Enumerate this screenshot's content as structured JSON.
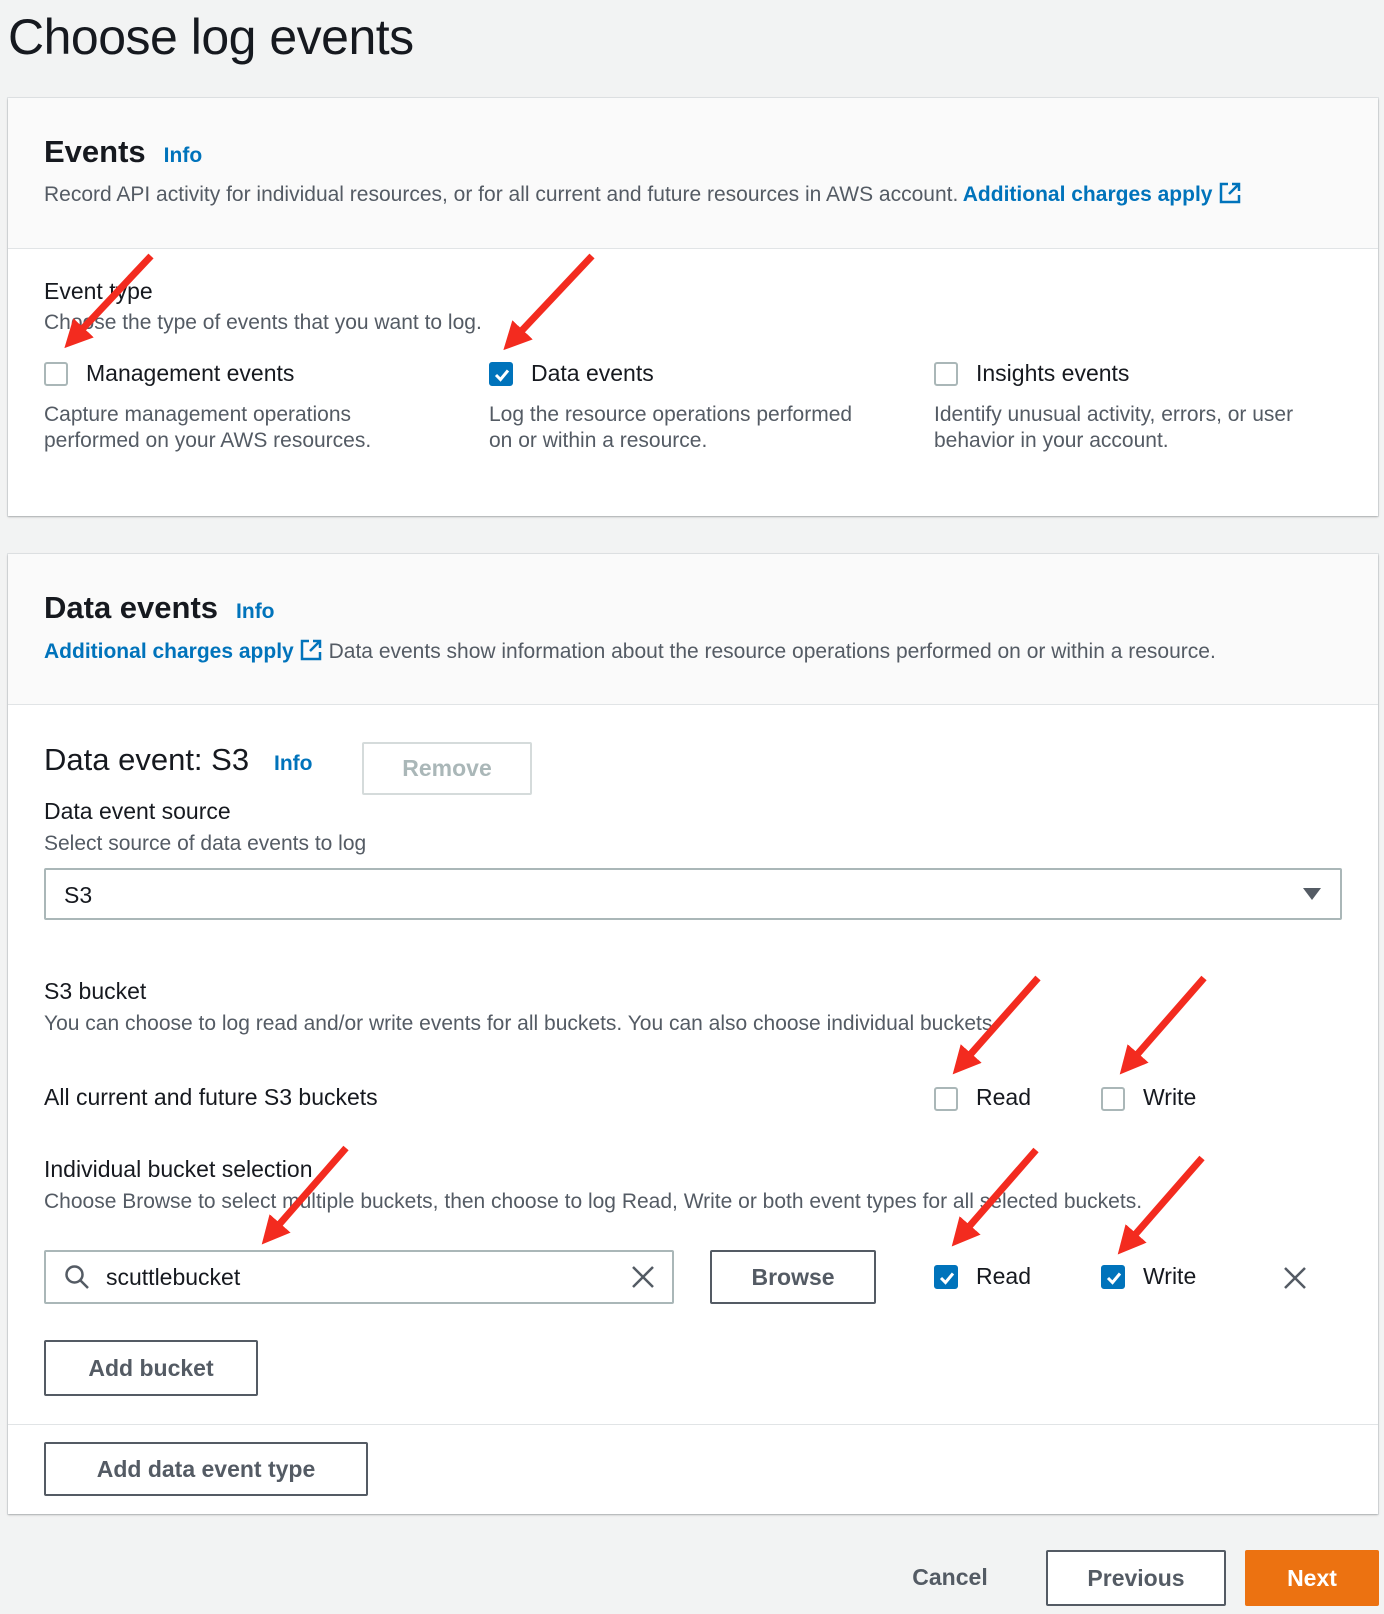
{
  "page": {
    "title": "Choose log events"
  },
  "events_panel": {
    "title": "Events",
    "info": "Info",
    "description": "Record API activity for individual resources, or for all current and future resources in AWS account.",
    "charges_link": "Additional charges apply",
    "event_type_label": "Event type",
    "event_type_desc": "Choose the type of events that you want to log.",
    "options": [
      {
        "label": "Management events",
        "desc1": "Capture management operations",
        "desc2": "performed on your AWS resources.",
        "checked": false
      },
      {
        "label": "Data events",
        "desc1": "Log the resource operations performed",
        "desc2": "on or within a resource.",
        "checked": true
      },
      {
        "label": "Insights events",
        "desc1": "Identify unusual activity, errors, or user",
        "desc2": "behavior in your account.",
        "checked": false
      }
    ]
  },
  "data_panel": {
    "title": "Data events",
    "info": "Info",
    "charges_link": "Additional charges apply",
    "description": "Data events show information about the resource operations performed on or within a resource.",
    "s3_title": "Data event: S3",
    "s3_info": "Info",
    "remove_label": "Remove",
    "source_label": "Data event source",
    "source_desc": "Select source of data events to log",
    "source_value": "S3",
    "bucket_label": "S3 bucket",
    "bucket_desc": "You can choose to log read and/or write events for all buckets. You can also choose individual buckets.",
    "all_buckets_label": "All current and future S3 buckets",
    "all_read_label": "Read",
    "all_write_label": "Write",
    "all_read_checked": false,
    "all_write_checked": false,
    "individual_label": "Individual bucket selection",
    "individual_desc": "Choose Browse to select multiple buckets, then choose to log Read, Write or both event types for all selected buckets.",
    "bucket_value": "scuttlebucket",
    "browse_label": "Browse",
    "ind_read_label": "Read",
    "ind_write_label": "Write",
    "ind_read_checked": true,
    "ind_write_checked": true,
    "add_bucket_label": "Add bucket",
    "add_type_label": "Add data event type"
  },
  "footer": {
    "cancel": "Cancel",
    "previous": "Previous",
    "next": "Next"
  },
  "colors": {
    "accent": "#0073bb",
    "primary_button": "#ec7211",
    "annotation_arrow": "#f32b1f"
  },
  "icons": [
    "external-link-icon",
    "search-icon",
    "clear-icon",
    "remove-row-icon",
    "dropdown-caret-icon",
    "checkmark-icon",
    "annotation-arrow"
  ]
}
